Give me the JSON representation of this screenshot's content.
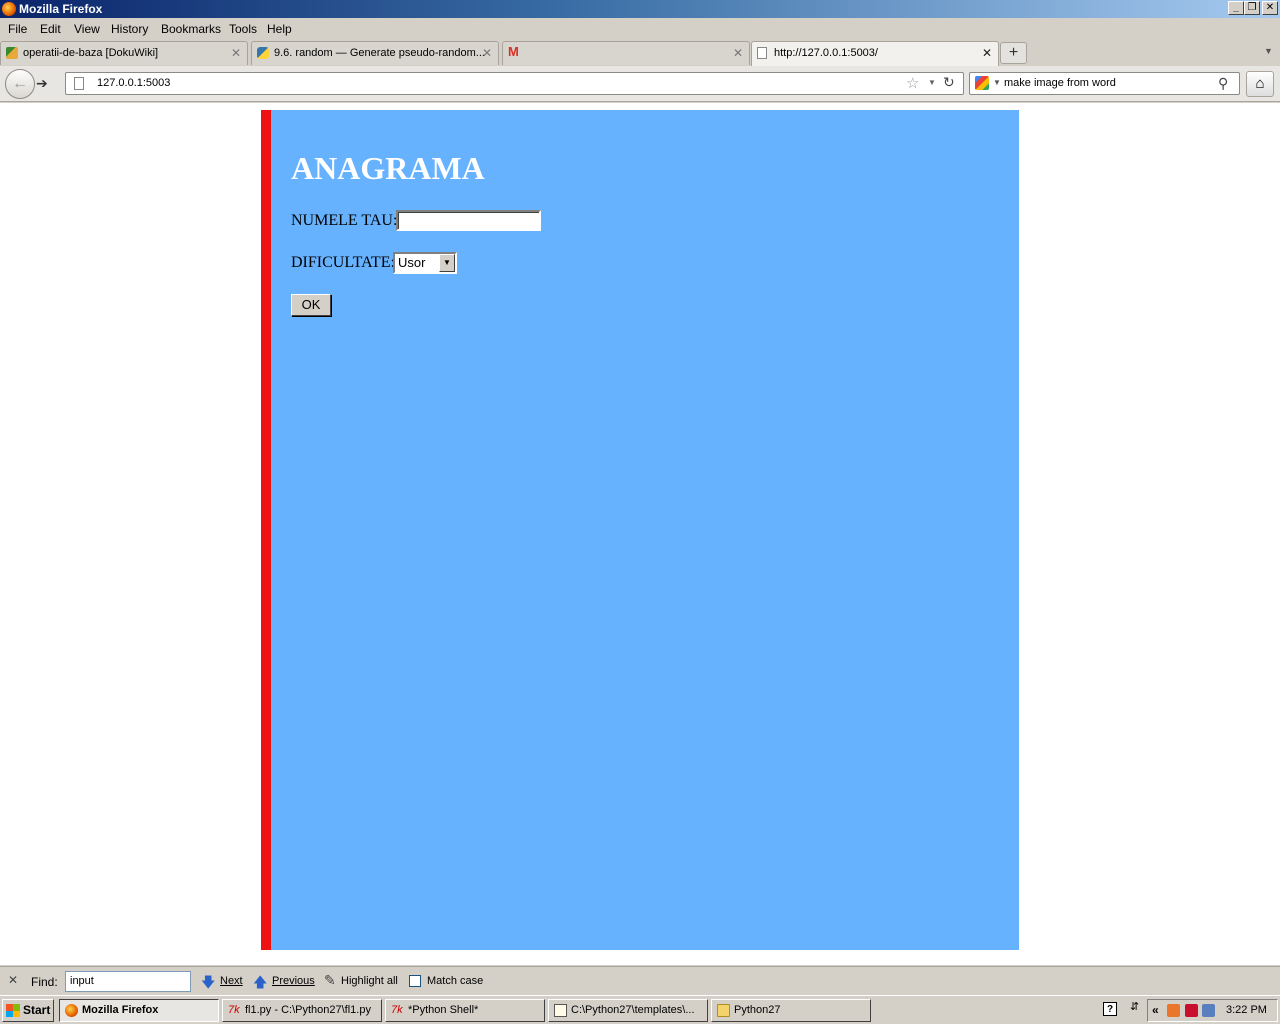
{
  "window": {
    "title": "Mozilla Firefox"
  },
  "menu": [
    "File",
    "Edit",
    "View",
    "History",
    "Bookmarks",
    "Tools",
    "Help"
  ],
  "tabs": [
    {
      "title": "operatii-de-baza [DokuWiki]",
      "icon": "dokuwiki-icon"
    },
    {
      "title": "9.6. random — Generate pseudo-random...",
      "icon": "python-icon"
    },
    {
      "title": "",
      "icon": "gmail-icon"
    },
    {
      "title": "http://127.0.0.1:5003/",
      "icon": "page-icon",
      "active": true
    }
  ],
  "nav": {
    "url": "127.0.0.1:5003",
    "search_value": "make image from word"
  },
  "page": {
    "heading": "ANAGRAMA",
    "name_label": "NUMELE TAU:",
    "name_value": "",
    "difficulty_label": "DIFICULTATE:",
    "difficulty_selected": "Usor",
    "ok_label": "OK",
    "colors": {
      "background": "#66b2ff",
      "left_border": "#ee1111",
      "heading": "#ffffff"
    }
  },
  "findbar": {
    "label": "Find:",
    "value": "input",
    "next": "Next",
    "previous": "Previous",
    "highlight_all": "Highlight all",
    "match_case": "Match case"
  },
  "taskbar": {
    "start": "Start",
    "items": [
      {
        "label": "Mozilla Firefox",
        "icon": "firefox-icon",
        "active": true
      },
      {
        "label": "fl1.py - C:\\Python27\\fl1.py",
        "icon": "idle-icon"
      },
      {
        "label": "*Python Shell*",
        "icon": "idle-icon"
      },
      {
        "label": "C:\\Python27\\templates\\...",
        "icon": "editor-icon"
      },
      {
        "label": "Python27",
        "icon": "folder-icon"
      }
    ],
    "clock": "3:22 PM"
  }
}
